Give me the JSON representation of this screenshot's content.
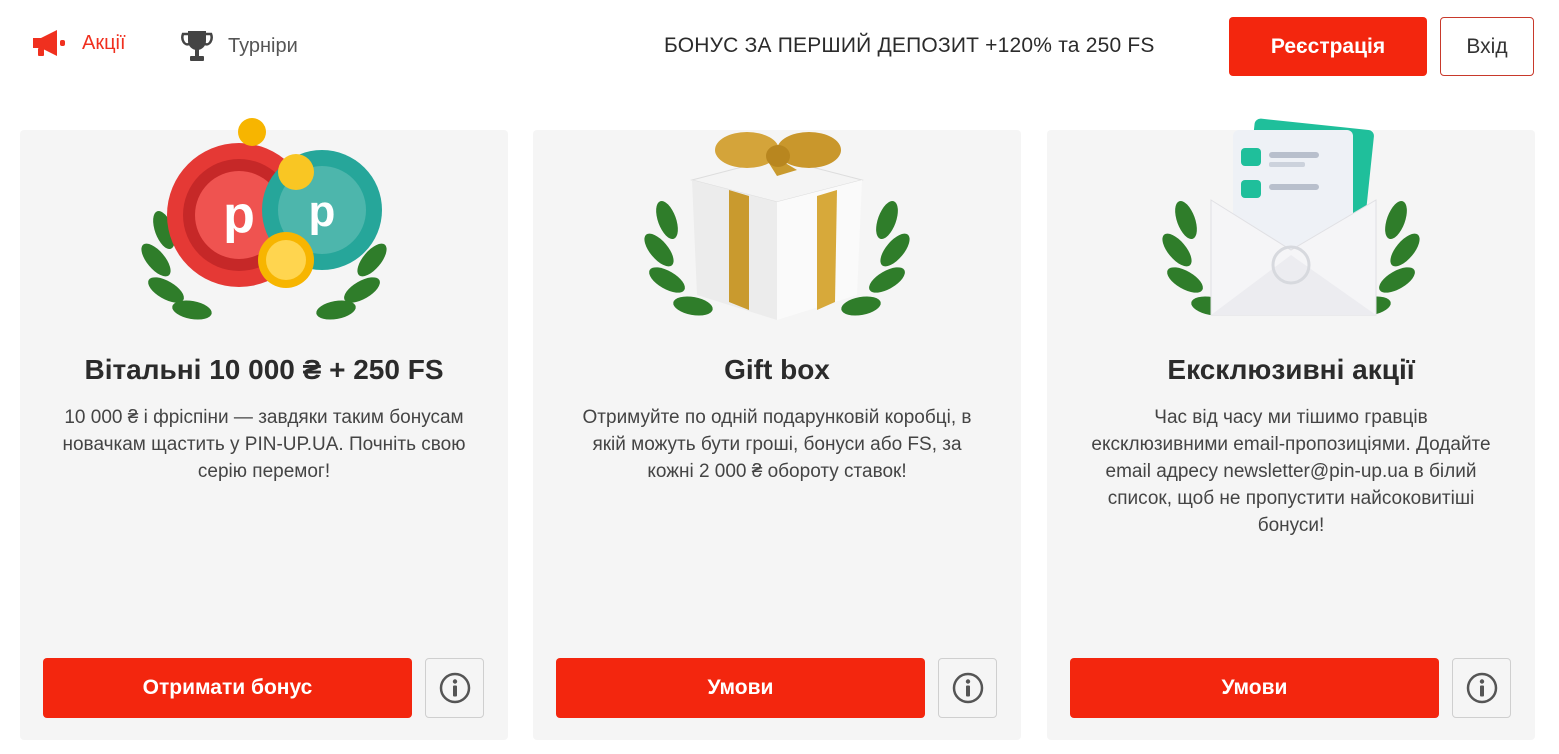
{
  "header": {
    "nav": [
      {
        "label": "Акції",
        "icon": "megaphone-icon",
        "active": true
      },
      {
        "label": "Турніри",
        "icon": "trophy-icon",
        "active": false
      }
    ],
    "bonus_text": "БОНУС ЗА ПЕРШИЙ ДЕПОЗИТ +120% та 250 FS",
    "register_label": "Реєстрація",
    "login_label": "Вхід"
  },
  "colors": {
    "accent": "#f3260e",
    "card_bg": "#f5f5f5",
    "text": "#2b2b2b"
  },
  "cards": [
    {
      "image": "poker-chips-and-coins-illustration",
      "title": "Вітальні 10 000 ₴ + 250 FS",
      "description": "10 000 ₴ і фріспіни — завдяки таким бонусам новачкам щастить у PIN-UP.UA. Почніть свою серію перемог!",
      "button_label": "Отримати бонус",
      "info_icon": "info-icon"
    },
    {
      "image": "gift-box-illustration",
      "title": "Gift box",
      "description": "Отримуйте по одній подарунковій коробці, в якій можуть бути гроші, бонуси або FS, за кожні 2 000 ₴ обороту ставок!",
      "button_label": "Умови",
      "info_icon": "info-icon"
    },
    {
      "image": "envelope-checklist-illustration",
      "title": "Ексклюзивні акції",
      "description": "Час від часу ми тішимо гравців ексклюзивними email-пропозиціями. Додайте email адресу newsletter@pin-up.ua в білий список, щоб не пропустити найсоковитіші бонуси!",
      "button_label": "Умови",
      "info_icon": "info-icon"
    }
  ]
}
